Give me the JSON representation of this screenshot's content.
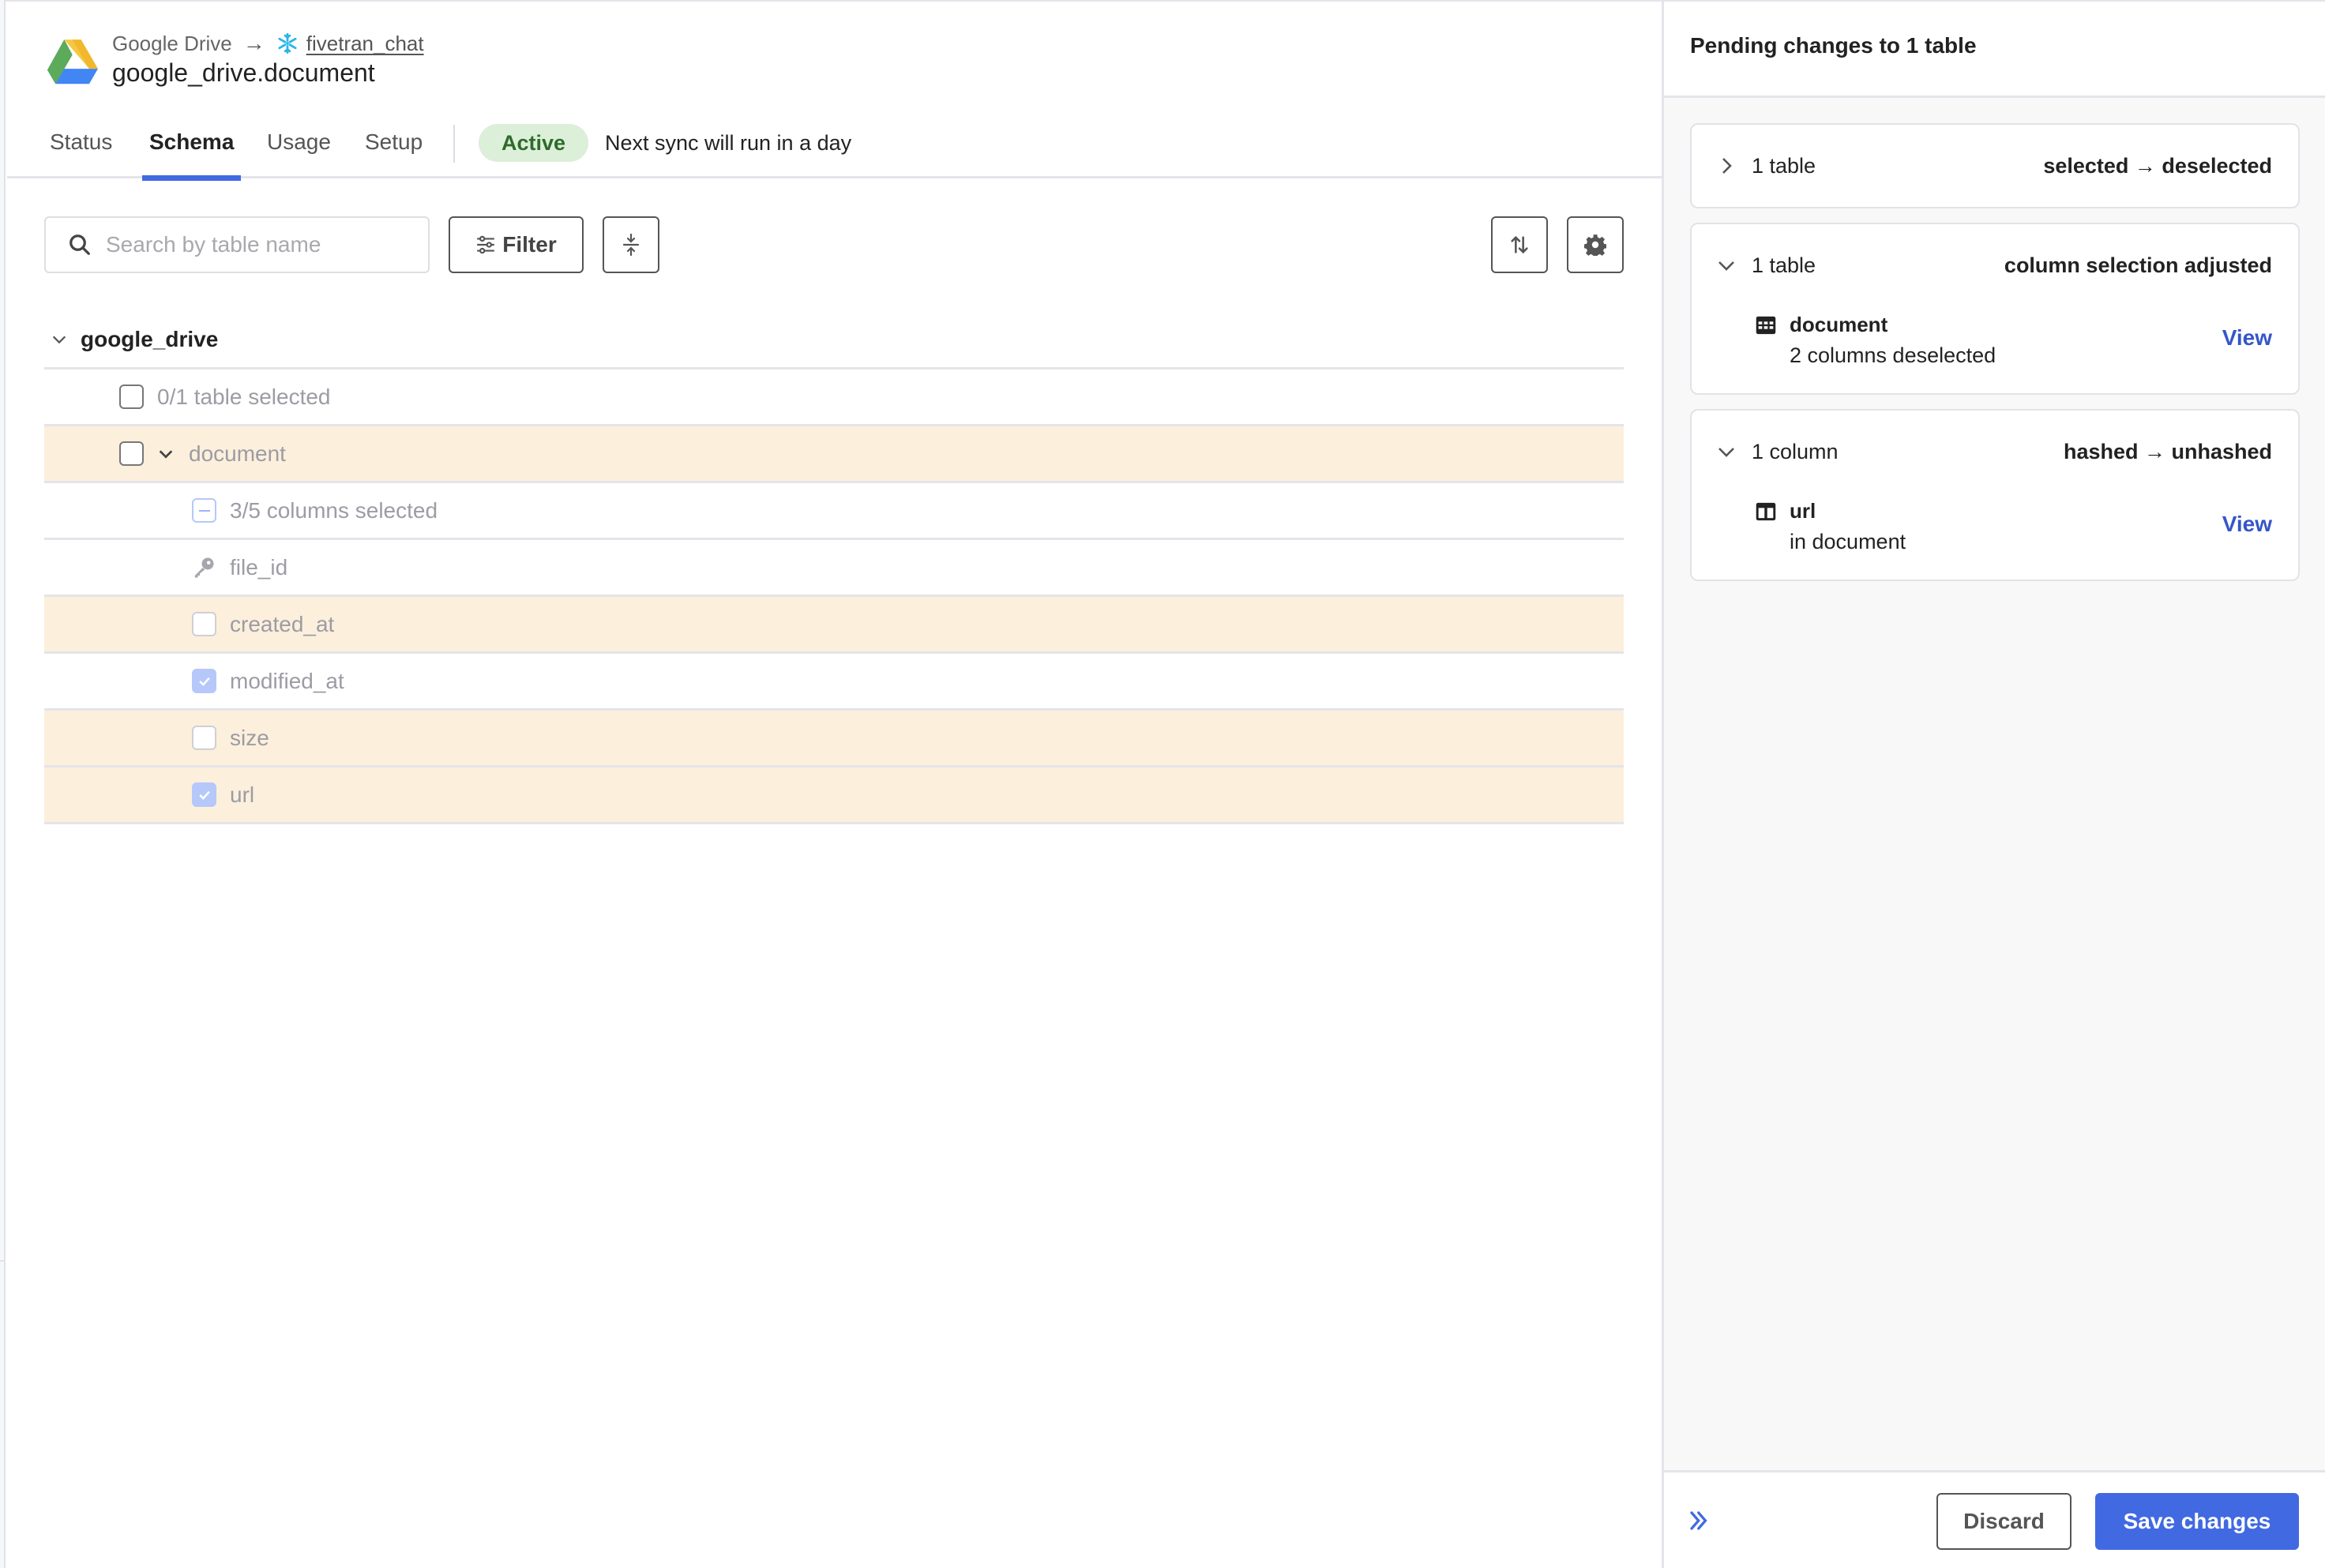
{
  "header": {
    "source_name": "Google Drive",
    "destination_name": "fivetran_chat",
    "title": "google_drive.document",
    "source_icon": "google-drive-logo",
    "destination_icon": "snowflake-icon"
  },
  "tabs": [
    {
      "label": "Status",
      "active": false
    },
    {
      "label": "Schema",
      "active": true
    },
    {
      "label": "Usage",
      "active": false
    },
    {
      "label": "Setup",
      "active": false
    }
  ],
  "status": {
    "badge": "Active",
    "sync_text": "Next sync will run in a day",
    "badge_color": "#2e6b2b",
    "badge_bg": "#dcefd9"
  },
  "toolbar": {
    "search_placeholder": "Search by table name",
    "search_value": "",
    "filter_label": "Filter"
  },
  "schema": {
    "name": "google_drive",
    "tables_summary": "0/1 table selected",
    "table": {
      "name": "document",
      "selected": false,
      "changed": true,
      "columns_summary": "3/5 columns selected",
      "columns": [
        {
          "name": "file_id",
          "type": "primary-key",
          "selected": true,
          "changed": false
        },
        {
          "name": "created_at",
          "type": "column",
          "selected": false,
          "changed": true
        },
        {
          "name": "modified_at",
          "type": "column",
          "selected": true,
          "changed": false
        },
        {
          "name": "size",
          "type": "column",
          "selected": false,
          "changed": true
        },
        {
          "name": "url",
          "type": "column",
          "selected": true,
          "changed": true
        }
      ]
    }
  },
  "pending": {
    "title": "Pending changes to 1 table",
    "groups": [
      {
        "count": "1 table",
        "change": "selected → deselected",
        "expanded": false
      },
      {
        "count": "1 table",
        "change": "column selection adjusted",
        "expanded": true,
        "item": {
          "icon": "table-icon",
          "name": "document",
          "detail": "2 columns deselected",
          "action": "View"
        }
      },
      {
        "count": "1 column",
        "change": "hashed → unhashed",
        "expanded": true,
        "item": {
          "icon": "column-icon",
          "name": "url",
          "detail": "in document",
          "action": "View"
        }
      }
    ],
    "discard_label": "Discard",
    "save_label": "Save changes",
    "accent": "#4169e1"
  }
}
